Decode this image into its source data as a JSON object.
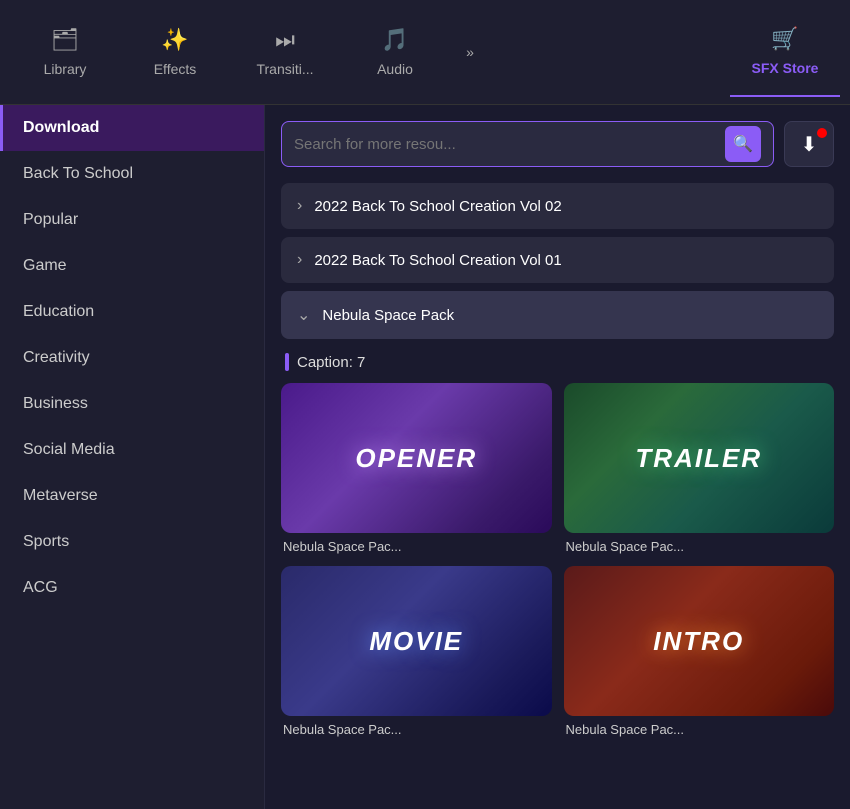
{
  "nav": {
    "items": [
      {
        "id": "library",
        "label": "Library",
        "icon": "🗂",
        "active": false
      },
      {
        "id": "effects",
        "label": "Effects",
        "icon": "✨",
        "active": false
      },
      {
        "id": "transitions",
        "label": "Transiti...",
        "icon": "⏭",
        "active": false
      },
      {
        "id": "audio",
        "label": "Audio",
        "icon": "🎵",
        "active": false
      },
      {
        "id": "sfx-store",
        "label": "SFX Store",
        "icon": "🛒",
        "active": true
      }
    ],
    "more_icon": "»"
  },
  "sidebar": {
    "items": [
      {
        "id": "download",
        "label": "Download",
        "active": true
      },
      {
        "id": "back-to-school",
        "label": "Back To School",
        "active": false
      },
      {
        "id": "popular",
        "label": "Popular",
        "active": false
      },
      {
        "id": "game",
        "label": "Game",
        "active": false
      },
      {
        "id": "education",
        "label": "Education",
        "active": false
      },
      {
        "id": "creativity",
        "label": "Creativity",
        "active": false
      },
      {
        "id": "business",
        "label": "Business",
        "active": false
      },
      {
        "id": "social-media",
        "label": "Social Media",
        "active": false
      },
      {
        "id": "metaverse",
        "label": "Metaverse",
        "active": false
      },
      {
        "id": "sports",
        "label": "Sports",
        "active": false
      },
      {
        "id": "acg",
        "label": "ACG",
        "active": false
      }
    ]
  },
  "search": {
    "placeholder": "Search for more resou..."
  },
  "list_items": [
    {
      "id": "vol02",
      "title": "2022 Back To School Creation Vol 02",
      "expanded": false
    },
    {
      "id": "vol01",
      "title": "2022 Back To School Creation Vol 01",
      "expanded": false
    },
    {
      "id": "nebula",
      "title": "Nebula Space Pack",
      "expanded": true
    }
  ],
  "caption": {
    "label": "Caption: 7"
  },
  "grid_items": [
    {
      "id": "opener",
      "label": "Nebula Space Pac...",
      "type": "opener",
      "text": "OPENER"
    },
    {
      "id": "trailer",
      "label": "Nebula Space Pac...",
      "type": "trailer",
      "text": "TRAILER"
    },
    {
      "id": "movie",
      "label": "Nebula Space Pac...",
      "type": "movie",
      "text": "MOVIE"
    },
    {
      "id": "intro",
      "label": "Nebula Space Pac...",
      "type": "intro",
      "text": "INTRO"
    }
  ]
}
